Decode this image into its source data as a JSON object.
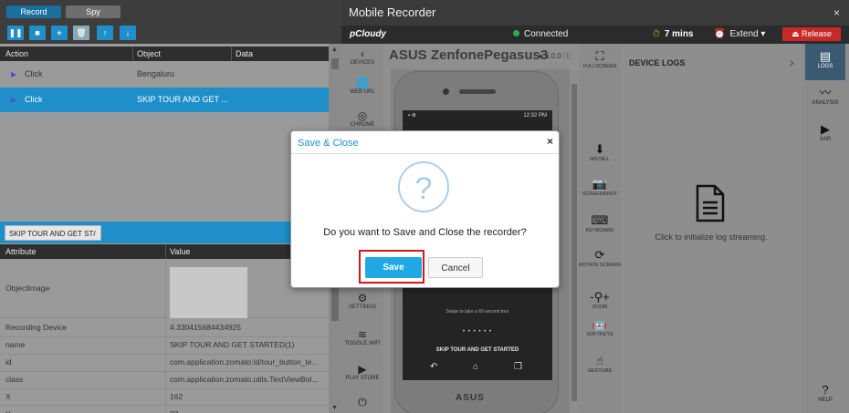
{
  "recorder": {
    "tabs": [
      "Record",
      "Spy"
    ],
    "toolbar_icons": [
      "pause-icon",
      "stop-icon",
      "add-icon",
      "delete-icon",
      "move-up-icon",
      "move-down-icon"
    ],
    "toolbar_glyphs": [
      "❚❚",
      "■",
      "+",
      "🗑",
      "↑",
      "↓"
    ],
    "columns": [
      "Action",
      "Object",
      "Data"
    ],
    "steps": [
      {
        "action": "Click",
        "object": "Bengaluru",
        "data": ""
      },
      {
        "action": "Click",
        "object": "SKIP TOUR AND GET ...",
        "data": ""
      }
    ],
    "selected_object_chip": "SKIP TOUR AND GET ST/",
    "prop_columns": [
      "Attribute",
      "Value"
    ],
    "properties": [
      {
        "attr": "ObjectImage",
        "value": ""
      },
      {
        "attr": "Recording Device",
        "value": "4.330415684434925"
      },
      {
        "attr": "name",
        "value": "SKIP TOUR AND GET STARTED(1)"
      },
      {
        "attr": "id",
        "value": "com.application.zomato:id/tour_button_te..."
      },
      {
        "attr": "class",
        "value": "com.application.zomato.utils.TextViewBol..."
      },
      {
        "attr": "X",
        "value": "162"
      },
      {
        "attr": "Y",
        "value": "32"
      }
    ]
  },
  "mobile": {
    "title": "Mobile Recorder",
    "close": "×",
    "logo": "pCloudy",
    "status": "Connected",
    "timer": "7 mins",
    "extend": "Extend",
    "release": "Release",
    "device_name": "ASUS ZenfonePegasus3",
    "os_version": "6.0.0",
    "left_sidebar": [
      {
        "icon": "‹",
        "label": "DEVICES"
      },
      {
        "icon": "🌐",
        "label": "WEB URL"
      },
      {
        "icon": "◎",
        "label": "CHROME"
      },
      {
        "icon": "⚙",
        "label": "SETTINGS"
      },
      {
        "icon": "≋",
        "label": "TOGGLE WIFI"
      },
      {
        "icon": "▶",
        "label": "PLAY STORE"
      },
      {
        "icon": "⏻",
        "label": ""
      }
    ],
    "phone": {
      "clock": "12:32 PM",
      "swipe_hint": "Swipe to take a 60-second tour",
      "page_dots": "• • • • • •",
      "cta": "SKIP TOUR AND GET STARTED",
      "brand": "ASUS",
      "nav_icons": [
        "↶",
        "⌂",
        "❐"
      ]
    },
    "tools": [
      {
        "icon": "⛶",
        "label": "FULLSCREEN"
      },
      {
        "icon": "⬇",
        "label": "INSTALL"
      },
      {
        "icon": "📷",
        "label": "SCREENSHOT"
      },
      {
        "icon": "⌨",
        "label": "KEYBOARD"
      },
      {
        "icon": "⟳",
        "label": "ROTATE SCREEN"
      },
      {
        "icon": "-⚲+",
        "label": "ZOOM"
      },
      {
        "icon": "🤖",
        "label": "SOFTKEYS"
      },
      {
        "icon": "☝",
        "label": "GESTURE"
      }
    ],
    "logs": {
      "title": "DEVICE LOGS",
      "message": "Click to initialize log streaming."
    },
    "right_sidebar": [
      {
        "icon": "▤",
        "label": "LOGS"
      },
      {
        "icon": "〰",
        "label": "ANALYSIS"
      },
      {
        "icon": "▶",
        "label": "AAR"
      },
      {
        "icon": "?",
        "label": "HELP"
      }
    ]
  },
  "dialog": {
    "title": "Save & Close",
    "close": "×",
    "icon": "?",
    "message": "Do you want to Save and Close the recorder?",
    "save": "Save",
    "cancel": "Cancel"
  },
  "colors": {
    "accent": "#1e8fc9",
    "release": "#c82828",
    "highlight": "#d8141b",
    "connected": "#25b04a"
  }
}
